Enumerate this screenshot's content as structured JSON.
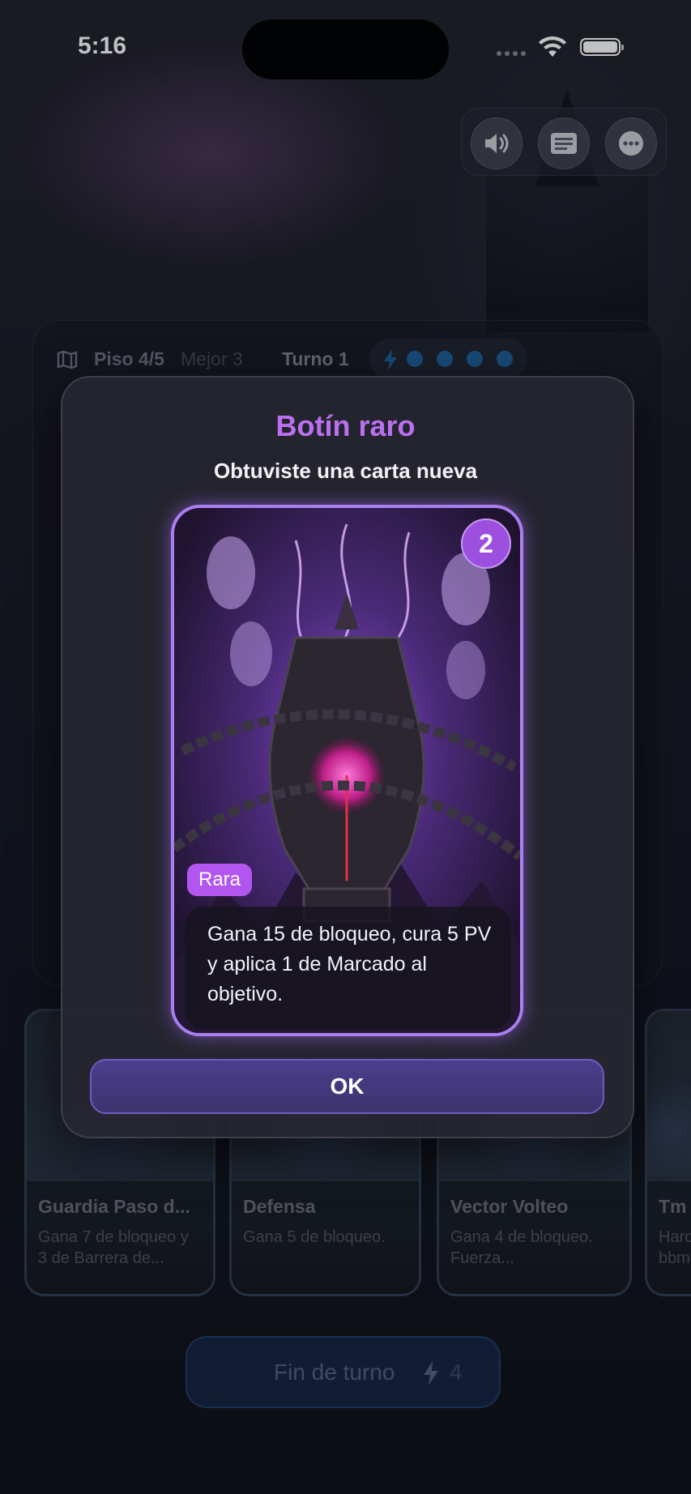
{
  "status_bar": {
    "time": "5:16"
  },
  "top_controls": {
    "items": [
      "sound-icon",
      "log-icon",
      "more-icon"
    ]
  },
  "hud": {
    "floor": "Piso 4/5",
    "best": "Mejor 3",
    "turn": "Turno 1",
    "energy_dots": 4
  },
  "hand": [
    {
      "name": "Guardia Paso d...",
      "desc": "Gana 7 de bloqueo y 3 de Barrera de..."
    },
    {
      "name": "Defensa",
      "desc": "Gana 5 de bloqueo."
    },
    {
      "name": "Vector Volteo",
      "desc": "Gana 4 de bloqueo. Fuerza..."
    },
    {
      "name": "Tm",
      "desc": "Harc bbm"
    }
  ],
  "end_turn": {
    "label": "Fin de turno",
    "cost": "4"
  },
  "modal": {
    "title": "Botín raro",
    "subtitle": "Obtuviste una carta nueva",
    "card": {
      "cost": "2",
      "rarity": "Rara",
      "text": "Gana 15 de bloqueo, cura 5 PV y aplica 1 de Marcado al objetivo."
    },
    "ok_label": "OK"
  },
  "colors": {
    "modal_title": "#bb70ef",
    "rarity_badge": "#b356ef",
    "card_border": "#a97ff0",
    "energy_dot": "#1f5f9b",
    "ok_button": "#4a3f8c"
  }
}
